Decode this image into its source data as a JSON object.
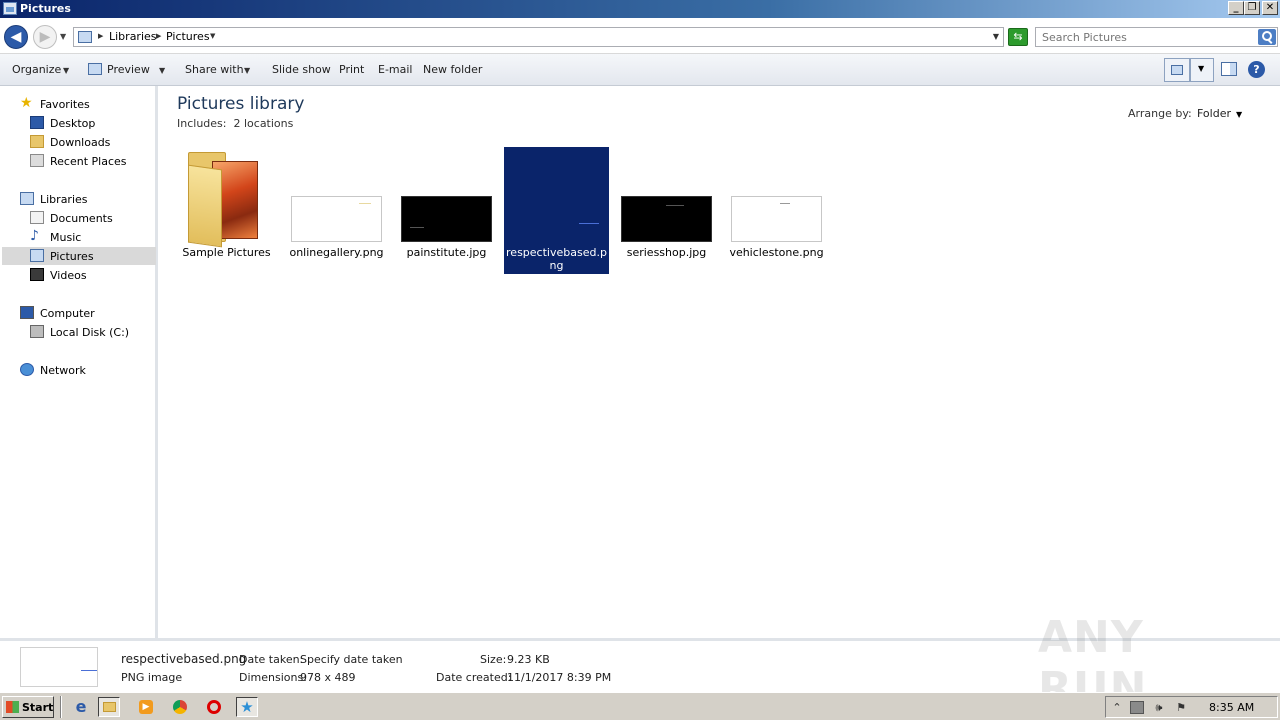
{
  "window": {
    "title": "Pictures"
  },
  "address": {
    "crumbs": [
      "Libraries",
      "Pictures"
    ],
    "search_placeholder": "Search Pictures"
  },
  "toolbar": {
    "organize": "Organize",
    "preview": "Preview",
    "share_with": "Share with",
    "slide_show": "Slide show",
    "print": "Print",
    "email": "E-mail",
    "new_folder": "New folder"
  },
  "nav": {
    "favorites": "Favorites",
    "desktop": "Desktop",
    "downloads": "Downloads",
    "recent_places": "Recent Places",
    "libraries": "Libraries",
    "documents": "Documents",
    "music": "Music",
    "pictures": "Pictures",
    "videos": "Videos",
    "computer": "Computer",
    "local_disk": "Local Disk (C:)",
    "network": "Network"
  },
  "library": {
    "title": "Pictures library",
    "includes_label": "Includes:",
    "includes_value": "2 locations",
    "arrange_label": "Arrange by:",
    "arrange_value": "Folder"
  },
  "files": [
    {
      "name": "Sample Pictures",
      "kind": "folder"
    },
    {
      "name": "onlinegallery.png",
      "kind": "image",
      "thumb_color": "#ffffff"
    },
    {
      "name": "painstitute.jpg",
      "kind": "image",
      "thumb_color": "#000000"
    },
    {
      "name": "respectivebased.png",
      "kind": "image",
      "thumb_color": "#0a246a",
      "selected": true
    },
    {
      "name": "seriesshop.jpg",
      "kind": "image",
      "thumb_color": "#000000"
    },
    {
      "name": "vehiclestone.png",
      "kind": "image",
      "thumb_color": "#ffffff"
    }
  ],
  "details": {
    "filename": "respectivebased.png",
    "type": "PNG image",
    "date_taken_label": "Date taken:",
    "date_taken_value": "Specify date taken",
    "dimensions_label": "Dimensions:",
    "dimensions_value": "978 x 489",
    "size_label": "Size:",
    "size_value": "9.23 KB",
    "date_created_label": "Date created:",
    "date_created_value": "11/1/2017 8:39 PM"
  },
  "watermark": "ANY RUN",
  "taskbar": {
    "start": "Start",
    "clock": "8:35 AM"
  },
  "colors": {
    "selection": "#0a246a",
    "title_bar": "#0a246a"
  }
}
